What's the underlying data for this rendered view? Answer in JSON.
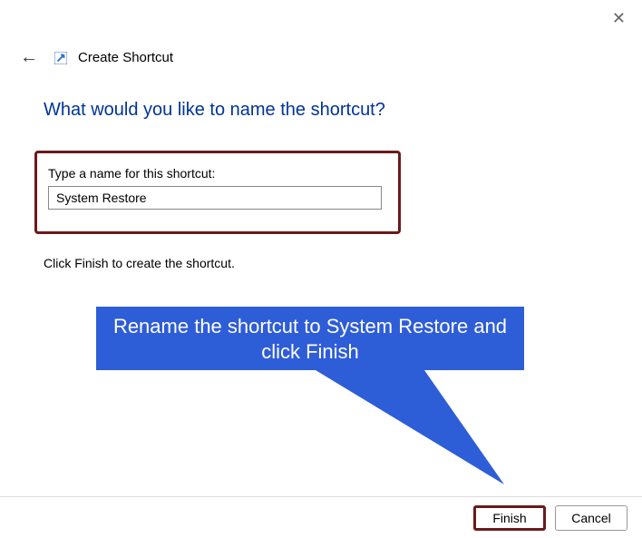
{
  "window": {
    "close_glyph": "✕"
  },
  "header": {
    "back_glyph": "←",
    "wizard_title": "Create Shortcut"
  },
  "main": {
    "heading": "What would you like to name the shortcut?",
    "label": "Type a name for this shortcut:",
    "input_value": "System Restore",
    "instruction": "Click Finish to create the shortcut."
  },
  "callout": {
    "text": "Rename the shortcut to System Restore and click Finish"
  },
  "footer": {
    "finish_label": "Finish",
    "cancel_label": "Cancel"
  }
}
